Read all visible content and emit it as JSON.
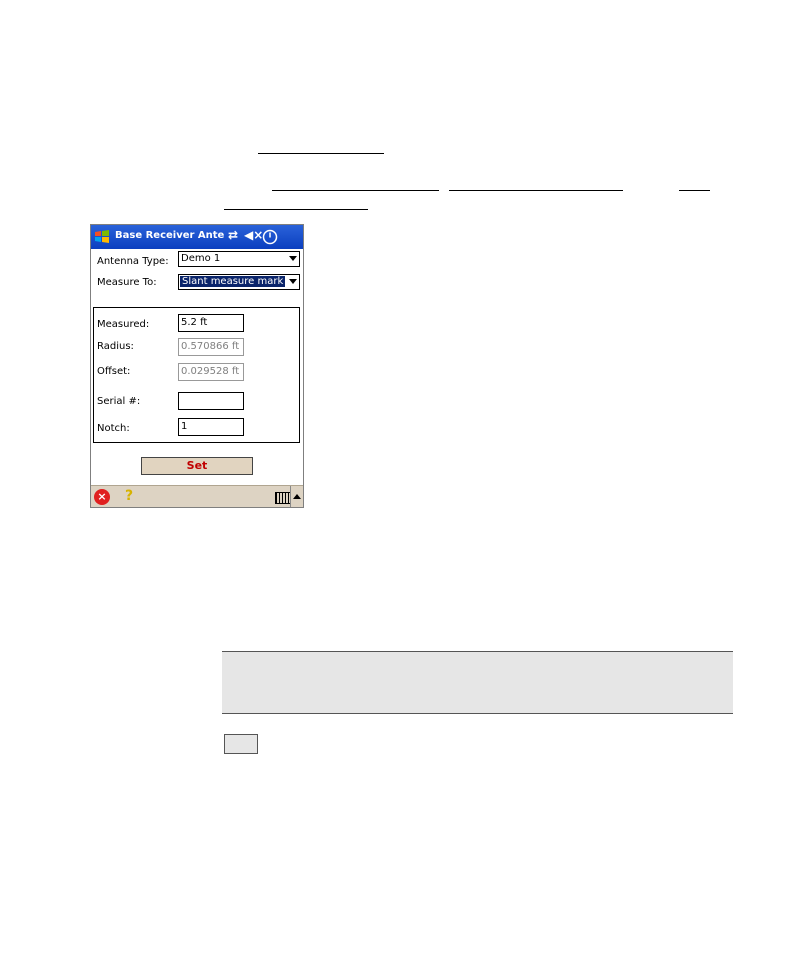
{
  "device": {
    "title": "Base Receiver Antenna",
    "status_icons": [
      "sync-icon",
      "speaker-mute-icon",
      "ok-icon"
    ],
    "antenna_type": {
      "label": "Antenna Type:",
      "value": "Demo 1"
    },
    "measure_to": {
      "label": "Measure To:",
      "value": "Slant measure mark"
    },
    "fields": [
      {
        "label": "Measured:",
        "value": "5.2 ft",
        "readonly": false
      },
      {
        "label": "Radius:",
        "value": "0.570866 ft",
        "readonly": true
      },
      {
        "label": "Offset:",
        "value": "0.029528 ft",
        "readonly": true
      },
      {
        "label": "Serial #:",
        "value": "",
        "readonly": false
      },
      {
        "label": "Notch:",
        "value": "1",
        "readonly": false
      }
    ],
    "set_button": "Set",
    "bottom_bar": {
      "icons": [
        "close-icon",
        "help-icon",
        "keyboard-icon",
        "arrow-up-icon"
      ]
    }
  }
}
